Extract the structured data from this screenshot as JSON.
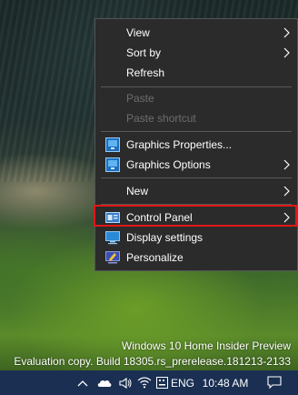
{
  "context_menu": {
    "items": [
      {
        "label": "View",
        "has_submenu": true,
        "enabled": true
      },
      {
        "label": "Sort by",
        "has_submenu": true,
        "enabled": true
      },
      {
        "label": "Refresh",
        "has_submenu": false,
        "enabled": true
      },
      {
        "label": "Paste",
        "has_submenu": false,
        "enabled": false
      },
      {
        "label": "Paste shortcut",
        "has_submenu": false,
        "enabled": false
      },
      {
        "label": "Graphics Properties...",
        "has_submenu": false,
        "enabled": true,
        "icon": "graphics-properties-icon"
      },
      {
        "label": "Graphics Options",
        "has_submenu": true,
        "enabled": true,
        "icon": "graphics-options-icon"
      },
      {
        "label": "New",
        "has_submenu": true,
        "enabled": true
      },
      {
        "label": "Control Panel",
        "has_submenu": true,
        "enabled": true,
        "icon": "control-panel-icon",
        "highlighted": true
      },
      {
        "label": "Display settings",
        "has_submenu": false,
        "enabled": true,
        "icon": "display-settings-icon"
      },
      {
        "label": "Personalize",
        "has_submenu": false,
        "enabled": true,
        "icon": "personalize-icon"
      }
    ],
    "highlight_color": "#e01818"
  },
  "watermark": {
    "line1": "Windows 10 Home Insider Preview",
    "line2": "Evaluation copy. Build 18305.rs_prerelease.181213-2133"
  },
  "taskbar": {
    "tray_icons": [
      "chevron-up-icon",
      "onedrive-cloud-icon",
      "speaker-icon",
      "wifi-icon",
      "keyboard-icon"
    ],
    "language": "ENG",
    "time": "10:48 AM",
    "action_center_icon": "notification-icon"
  },
  "colors": {
    "menu_bg": "#2b2b2b",
    "menu_text": "#ffffff",
    "menu_disabled_text": "#6d6d6d",
    "taskbar_bg": "#1a2f52"
  }
}
